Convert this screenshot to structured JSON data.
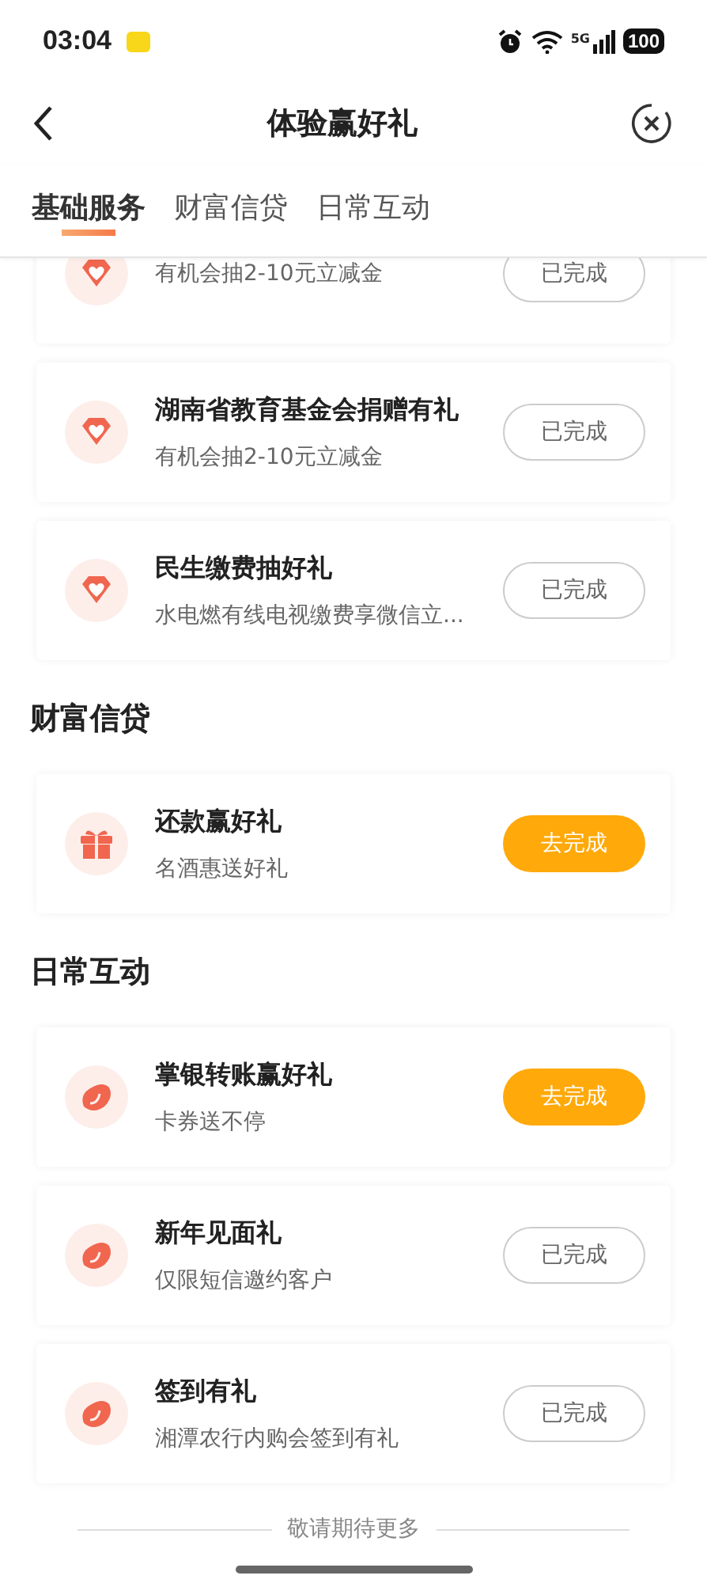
{
  "status_bar": {
    "time": "03:04",
    "network": "5G",
    "battery": "100"
  },
  "nav": {
    "title": "体验赢好礼"
  },
  "tabs": [
    {
      "label": "基础服务",
      "selected": true
    },
    {
      "label": "财富信贷",
      "selected": false
    },
    {
      "label": "日常互动",
      "selected": false
    }
  ],
  "sections": [
    {
      "tasks": [
        {
          "kind": "gem",
          "description": "有机会抽2-10元立减金",
          "button": "已完成",
          "done": true
        },
        {
          "kind": "gem",
          "title": "湖南省教育基金会捐赠有礼",
          "description": "有机会抽2-10元立减金",
          "button": "已完成",
          "done": true
        },
        {
          "kind": "gem",
          "title": "民生缴费抽好礼",
          "description": "水电燃有线电视缴费享微信立...",
          "button": "已完成",
          "done": true
        }
      ]
    },
    {
      "heading": "财富信贷",
      "tasks": [
        {
          "kind": "gift",
          "title": "还款赢好礼",
          "description": "名酒惠送好礼",
          "button": "去完成",
          "done": false
        }
      ]
    },
    {
      "heading": "日常互动",
      "tasks": [
        {
          "kind": "bean",
          "title": "掌银转账赢好礼",
          "description": "卡券送不停",
          "button": "去完成",
          "done": false
        },
        {
          "kind": "bean",
          "title": "新年见面礼",
          "description": "仅限短信邀约客户",
          "button": "已完成",
          "done": true
        },
        {
          "kind": "bean",
          "title": "签到有礼",
          "description": "湘潭农行内购会签到有礼",
          "button": "已完成",
          "done": true
        }
      ]
    }
  ],
  "footer": "敬请期待更多"
}
